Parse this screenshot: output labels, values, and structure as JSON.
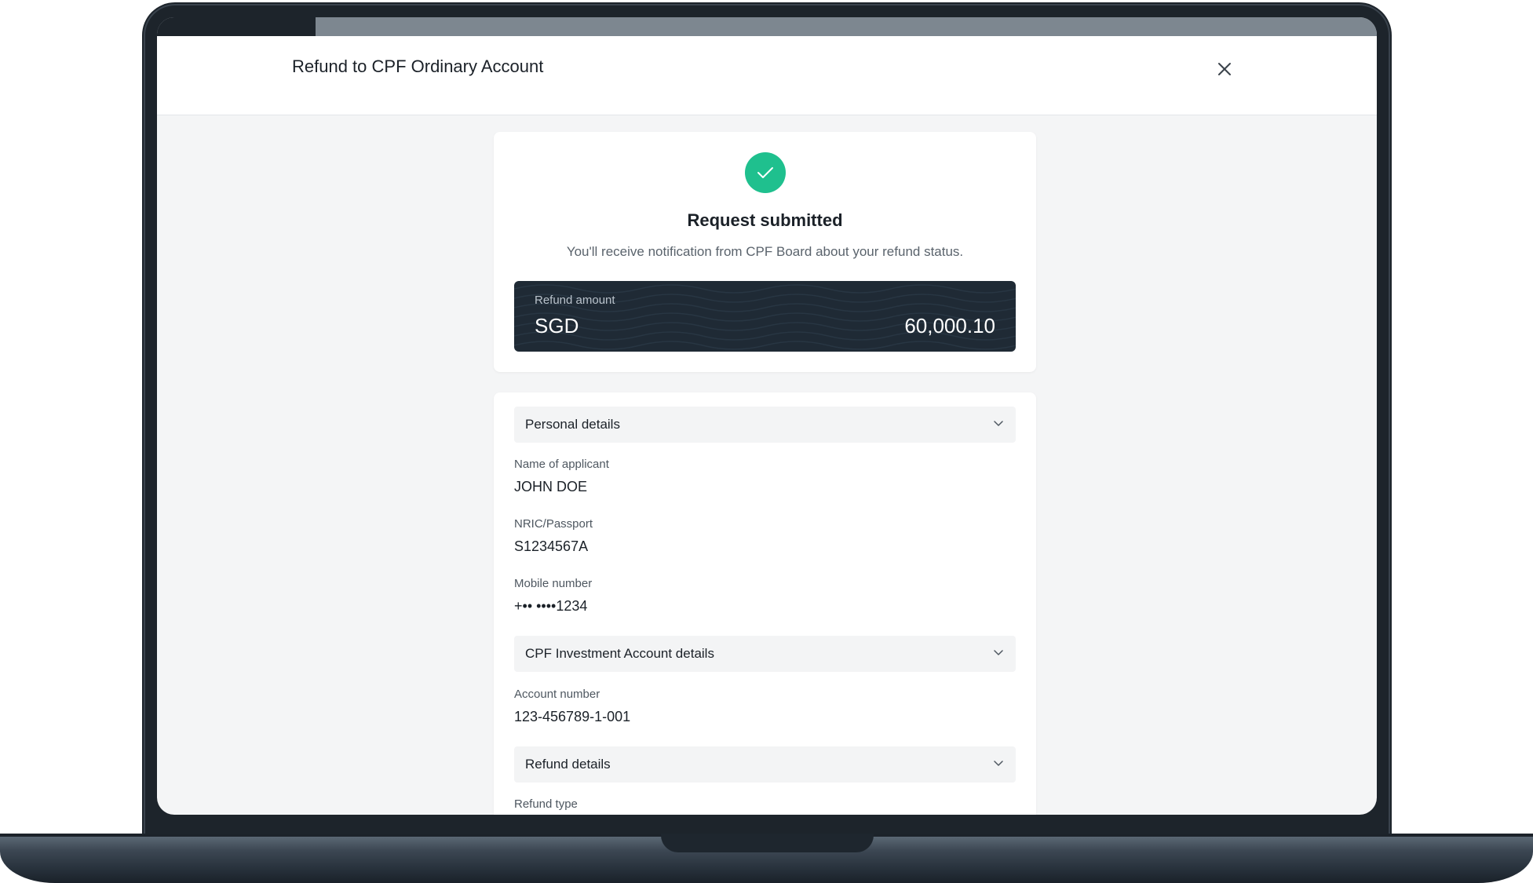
{
  "progress": {
    "fraction": 0.13
  },
  "header": {
    "title": "Refund to CPF Ordinary Account"
  },
  "success": {
    "title": "Request submitted",
    "description": "You'll receive notification from CPF Board about your refund status.",
    "accent_color": "#1fc08e"
  },
  "amount": {
    "label": "Refund amount",
    "currency": "SGD",
    "value": "60,000.10"
  },
  "sections": {
    "personal": {
      "title": "Personal details",
      "fields": [
        {
          "label": "Name of applicant",
          "value": "JOHN DOE"
        },
        {
          "label": "NRIC/Passport",
          "value": "S1234567A"
        },
        {
          "label": "Mobile number",
          "value": "+•• ••••1234"
        }
      ]
    },
    "investment": {
      "title": "CPF Investment Account details",
      "fields": [
        {
          "label": "Account number",
          "value": "123-456789-1-001"
        }
      ]
    },
    "refund": {
      "title": "Refund details",
      "fields": [
        {
          "label": "Refund type",
          "value": ""
        }
      ]
    }
  },
  "icons": {
    "close": "close-icon",
    "success": "check-icon",
    "chevron": "chevron-down-icon"
  }
}
